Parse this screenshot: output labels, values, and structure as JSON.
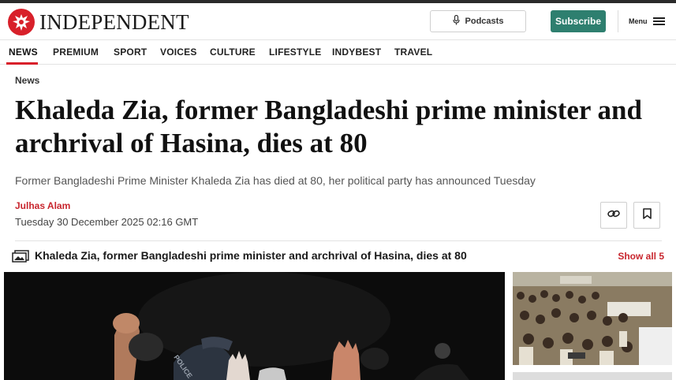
{
  "header": {
    "logo_text": "INDEPENDENT",
    "podcasts_label": "Podcasts",
    "subscribe_label": "Subscribe",
    "menu_label": "Menu"
  },
  "nav": {
    "items": [
      "NEWS",
      "PREMIUM",
      "SPORT",
      "VOICES",
      "CULTURE",
      "LIFESTYLE",
      "INDYBEST",
      "TRAVEL"
    ],
    "active": "NEWS"
  },
  "article": {
    "section": "News",
    "headline": "Khaleda Zia, former Bangladeshi prime minister and archrival of Hasina, dies at 80",
    "standfirst": "Former Bangladeshi Prime Minister Khaleda Zia has died at 80, her political party has announced Tuesday",
    "author": "Julhas Alam",
    "date": "Tuesday 30 December 2025 02:16 GMT"
  },
  "gallery": {
    "title": "Khaleda Zia, former Bangladeshi prime minister and archrival of Hasina, dies at 80",
    "show_all_label": "Show all 5"
  },
  "photo": {
    "helmet_text": "POLICE"
  },
  "colors": {
    "brand_red": "#d8202a",
    "subscribe_green": "#2e7f6f",
    "link_red": "#c8262e"
  },
  "icons": [
    "eagle-logo-icon",
    "microphone-icon",
    "hamburger-menu-icon",
    "share-link-icon",
    "bookmark-icon",
    "gallery-icon"
  ]
}
